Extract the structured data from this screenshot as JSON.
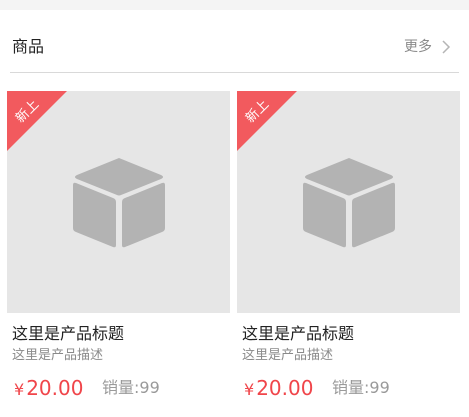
{
  "section": {
    "title": "商品",
    "more_label": "更多"
  },
  "products": [
    {
      "badge": "新上",
      "name": "这里是产品标题",
      "desc": "这里是产品描述",
      "currency": "¥",
      "price": "20.00",
      "sales": "销量:99"
    },
    {
      "badge": "新上",
      "name": "这里是产品标题",
      "desc": "这里是产品描述",
      "currency": "¥",
      "price": "20.00",
      "sales": "销量:99"
    }
  ],
  "colors": {
    "accent": "#f0454a",
    "badge": "#f25a5e",
    "placeholder_bg": "#e6e6e6",
    "placeholder_icon": "#b3b3b3"
  },
  "icons": {
    "more": "chevron-right-icon",
    "placeholder": "box-icon"
  }
}
